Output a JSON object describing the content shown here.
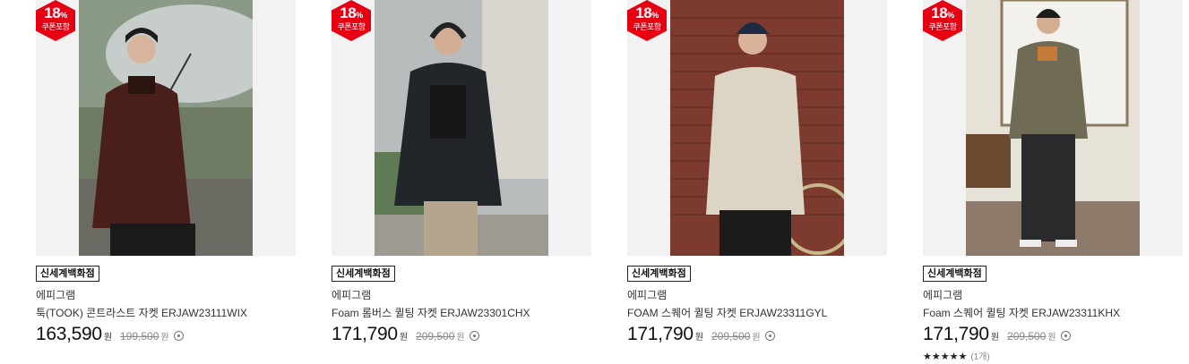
{
  "colors": {
    "coupon": "#e60012",
    "text": "#222222",
    "muted": "#888888",
    "thumb_bg": "#f2f2f2"
  },
  "products": [
    {
      "coupon_percent": "18",
      "coupon_percent_sign": "%",
      "coupon_label": "쿠폰포함",
      "store": "신세계백화점",
      "brand": "에피그램",
      "name": "툭(TOOK) 콘트라스트 자켓 ERJAW23111WIX",
      "price": "163,590",
      "price_unit": "원",
      "original_price": "199,500",
      "original_unit": "원",
      "image": "man-with-umbrella-burgundy-jacket"
    },
    {
      "coupon_percent": "18",
      "coupon_percent_sign": "%",
      "coupon_label": "쿠폰포함",
      "store": "신세계백화점",
      "brand": "에피그램",
      "name": "Foam 롬버스 퀼팅 자켓 ERJAW23301CHX",
      "price": "171,790",
      "price_unit": "원",
      "original_price": "209,500",
      "original_unit": "원",
      "image": "man-with-headphones-black-quilted-jacket"
    },
    {
      "coupon_percent": "18",
      "coupon_percent_sign": "%",
      "coupon_label": "쿠폰포함",
      "store": "신세계백화점",
      "brand": "에피그램",
      "name": "FOAM 스퀘어 퀼팅 자켓 ERJAW23311GYL",
      "price": "171,790",
      "price_unit": "원",
      "original_price": "209,500",
      "original_unit": "원",
      "image": "man-with-bicycle-ivory-quilted-jacket"
    },
    {
      "coupon_percent": "18",
      "coupon_percent_sign": "%",
      "coupon_label": "쿠폰포함",
      "store": "신세계백화점",
      "brand": "에피그램",
      "name": "Foam 스퀘어 퀼팅 자켓 ERJAW23311KHX",
      "price": "171,790",
      "price_unit": "원",
      "original_price": "209,500",
      "original_unit": "원",
      "image": "man-in-room-khaki-quilted-jacket",
      "rating_stars": "★★★★★",
      "rating_count": "(1개)"
    }
  ]
}
